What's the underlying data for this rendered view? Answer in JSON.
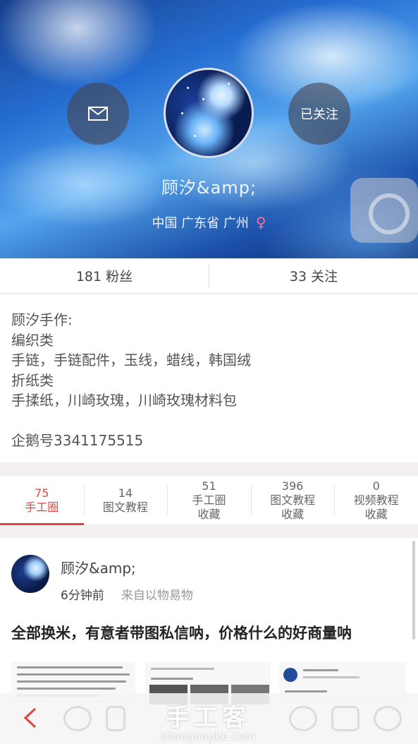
{
  "profile": {
    "username": "顾汐&amp;",
    "location": "中国 广东省 广州",
    "gender_icon": "female-icon",
    "message_icon": "envelope-icon",
    "follow_label": "已关注"
  },
  "stats": {
    "fans": "181 粉丝",
    "following": "33 关注"
  },
  "bio": {
    "lines": [
      "顾汐手作:",
      "编织类",
      "手链，手链配件，玉线，蜡线，韩国绒",
      "折纸类",
      "手揉纸，川崎玫瑰，川崎玫瑰材料包"
    ],
    "qq": "企鹅号3341175515"
  },
  "tabs": [
    {
      "count": "75",
      "label": "手工圈",
      "label2": "",
      "active": true
    },
    {
      "count": "14",
      "label": "图文教程",
      "label2": "",
      "active": false
    },
    {
      "count": "51",
      "label": "手工圈",
      "label2": "收藏",
      "active": false
    },
    {
      "count": "396",
      "label": "图文教程",
      "label2": "收藏",
      "active": false
    },
    {
      "count": "0",
      "label": "视频教程",
      "label2": "收藏",
      "active": false
    }
  ],
  "post": {
    "username": "顾汐&amp;",
    "time": "6分钟前",
    "source": "来自以物易物",
    "text": "全部换米，有意者带图私信呐，价格什么的好商量呐"
  },
  "watermark": {
    "logo": "手工客",
    "url": "shougongke.com"
  },
  "colors": {
    "accent": "#e0443d",
    "female": "#ff6f96"
  }
}
